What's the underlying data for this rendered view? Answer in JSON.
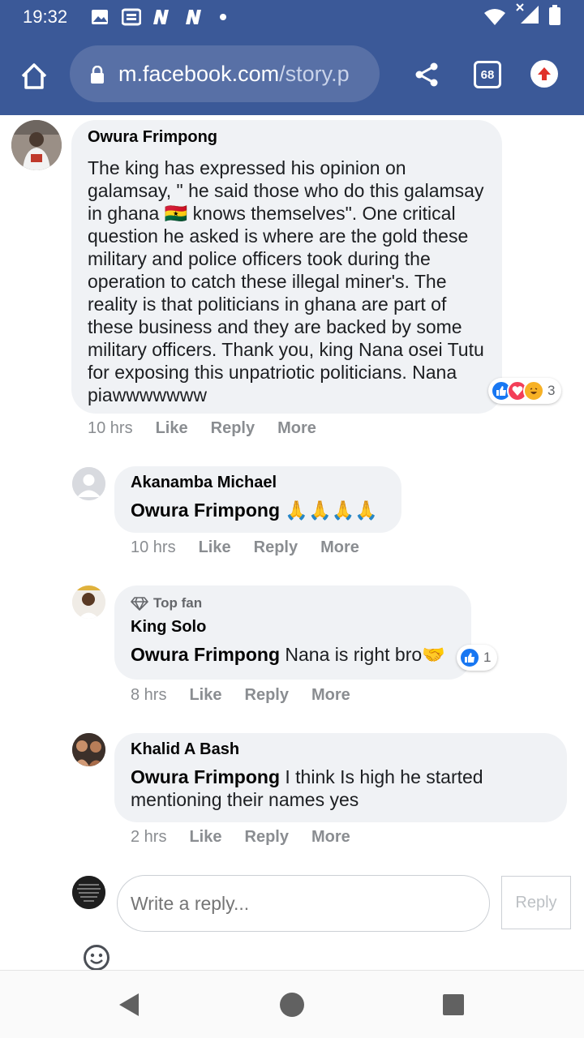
{
  "status_bar": {
    "time": "19:32",
    "icons": [
      "gallery-icon",
      "news-icon",
      "n-app-icon",
      "n-app-icon",
      "dot-icon",
      "wifi-icon",
      "signal-icon",
      "battery-icon"
    ]
  },
  "browser": {
    "url_domain": "m.facebook.com",
    "url_path": "/story.p",
    "tab_count": "68"
  },
  "comment": {
    "author": "Owura Frimpong",
    "text": "The king has expressed his opinion on galamsay, \" he said those who do this galamsay in ghana 🇬🇭 knows themselves\". One critical question he asked is where are the gold these military and police officers took during the operation to catch these illegal miner's. The reality is that politicians in ghana are part of these business and they are backed by some military officers. Thank you, king Nana osei Tutu for exposing this unpatriotic politicians. Nana piawwwwwww",
    "reaction_count": "3",
    "time": "10 hrs",
    "like": "Like",
    "reply": "Reply",
    "more": "More"
  },
  "replies": [
    {
      "author": "Akanamba Michael",
      "mention": "Owura Frimpong",
      "text": " 🙏🙏🙏🙏",
      "time": "10 hrs",
      "like": "Like",
      "reply": "Reply",
      "more": "More"
    },
    {
      "badge": "Top fan",
      "author": "King Solo",
      "mention": "Owura Frimpong",
      "text": " Nana is right bro🤝",
      "reaction_count": "1",
      "time": "8 hrs",
      "like": "Like",
      "reply": "Reply",
      "more": "More"
    },
    {
      "author": "Khalid A Bash",
      "mention": "Owura Frimpong",
      "text": " I think Is high he started mentioning their names yes",
      "time": "2 hrs",
      "like": "Like",
      "reply": "Reply",
      "more": "More"
    }
  ],
  "composer": {
    "placeholder": "Write a reply...",
    "submit": "Reply"
  },
  "colors": {
    "brand": "#3b5998",
    "bubble": "#f0f2f5",
    "like_blue": "#1877f2"
  }
}
